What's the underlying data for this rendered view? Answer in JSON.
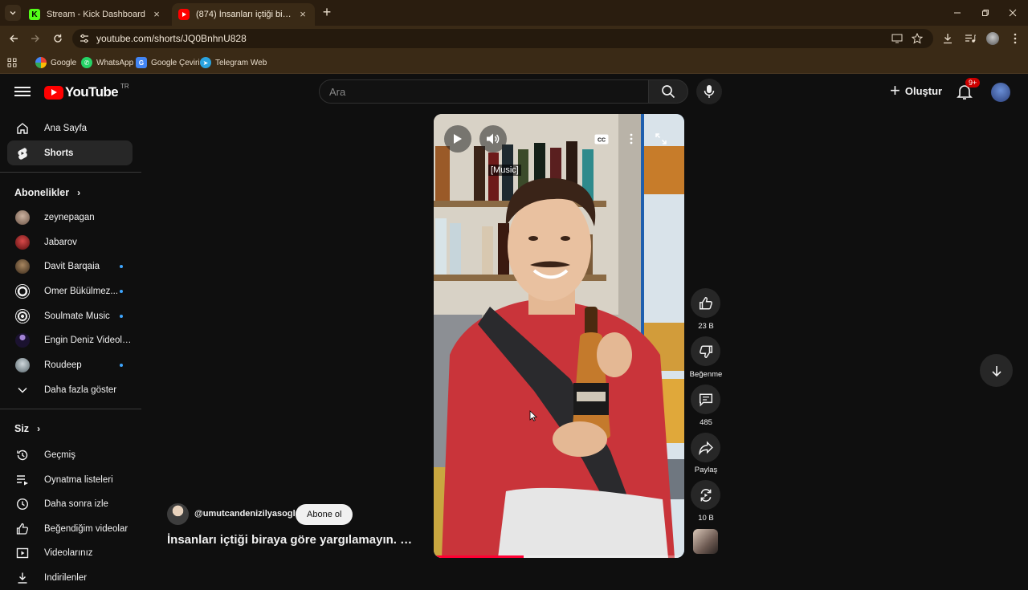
{
  "browser": {
    "tabs": [
      {
        "title": "Stream - Kick Dashboard",
        "favicon": "kick-icon",
        "active": false
      },
      {
        "title": "(874) İnsanları içtiği biraya göre yargılamayın. …",
        "favicon": "youtube-icon",
        "active": true
      }
    ],
    "url": "youtube.com/shorts/JQ0BnhnU828",
    "bookmarks": [
      {
        "label": "Google",
        "icon": "google-icon"
      },
      {
        "label": "WhatsApp",
        "icon": "whatsapp-icon"
      },
      {
        "label": "Google Çeviri",
        "icon": "translate-icon"
      },
      {
        "label": "Telegram Web",
        "icon": "telegram-icon"
      }
    ]
  },
  "header": {
    "logo_text": "YouTube",
    "country": "TR",
    "search_placeholder": "Ara",
    "create_label": "Oluştur",
    "notification_count": "9+"
  },
  "sidebar": {
    "main": [
      {
        "label": "Ana Sayfa",
        "icon": "home-icon",
        "active": false
      },
      {
        "label": "Shorts",
        "icon": "shorts-icon",
        "active": true
      }
    ],
    "subscriptions_title": "Abonelikler",
    "subscriptions": [
      {
        "label": "zeynepagan",
        "color": "#8b6f5e",
        "new": false
      },
      {
        "label": "Jabarov",
        "color": "#9b1c1c",
        "new": false
      },
      {
        "label": "Davit Barqaia",
        "color": "#5a4632",
        "new": true
      },
      {
        "label": "Ömer Bükülmez...",
        "color": "#e8e8e8",
        "new": true
      },
      {
        "label": "Soulmate Music",
        "color": "#e8e8e8",
        "new": true
      },
      {
        "label": "Engin Deniz Videoları",
        "color": "#3b2a5a",
        "new": false
      },
      {
        "label": "Roudeep",
        "color": "#7d8a8f",
        "new": true
      }
    ],
    "show_more": "Daha fazla göster",
    "you_title": "Siz",
    "you_items": [
      {
        "label": "Geçmiş",
        "icon": "history-icon"
      },
      {
        "label": "Oynatma listeleri",
        "icon": "playlist-icon"
      },
      {
        "label": "Daha sonra izle",
        "icon": "clock-icon"
      },
      {
        "label": "Beğendiğim videolar",
        "icon": "thumbs-up-icon"
      },
      {
        "label": "Videolarınız",
        "icon": "your-videos-icon"
      },
      {
        "label": "İndirilenler",
        "icon": "download-icon"
      }
    ]
  },
  "video": {
    "caption": "[Music]",
    "progress": 0.36,
    "channel": "@umutcandenizilyasoglu",
    "subscribe_label": "Abone ol",
    "title": "İnsanları içtiği biraya göre yargılamayın. …"
  },
  "actions": {
    "likes": "23 B",
    "dislike_label": "Beğenme",
    "comments": "485",
    "share_label": "Paylaş",
    "remix": "10 B"
  }
}
